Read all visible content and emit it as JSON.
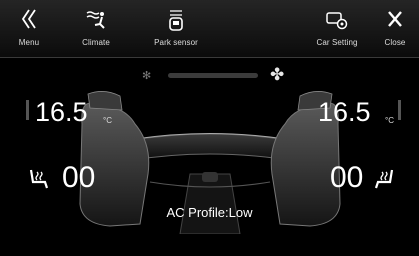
{
  "topbar": {
    "menu": {
      "label": "Menu",
      "icon": "menu-chevron-icon"
    },
    "climate": {
      "label": "Climate",
      "icon": "climate-icon"
    },
    "park_sensor": {
      "label": "Park sensor",
      "icon": "park-sensor-icon"
    },
    "car_setting": {
      "label": "Car Setting",
      "icon": "car-setting-icon"
    },
    "close": {
      "label": "Close",
      "icon": "close-icon"
    }
  },
  "climate": {
    "fan_level": 0.0,
    "left_temp": "16.5",
    "right_temp": "16.5",
    "unit": "°C",
    "left_seat_heat": "00",
    "right_seat_heat": "00",
    "ac_profile": "AC Profile:Low"
  },
  "colors": {
    "background": "#000000",
    "text": "#ffffff",
    "fan_bar": "#3b3b3b"
  }
}
